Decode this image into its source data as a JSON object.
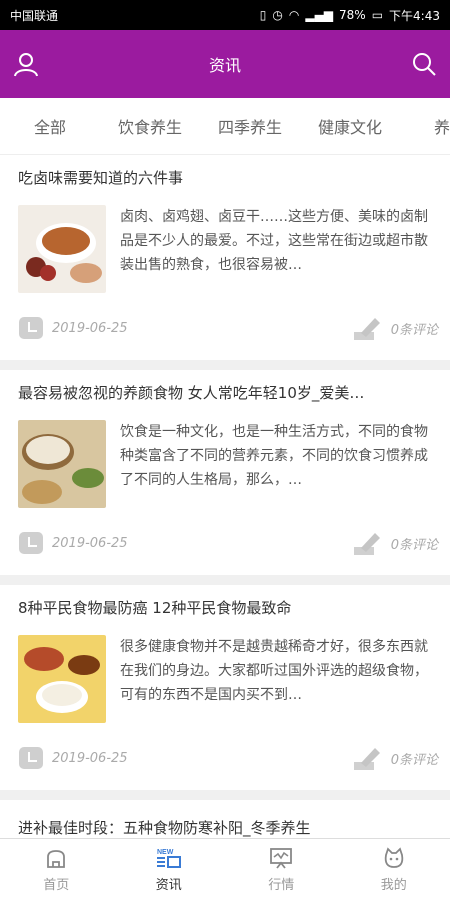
{
  "status_bar": {
    "carrier": "中国联通",
    "battery": "78%",
    "time": "下午4:43",
    "vibrate_icon": "vibrate-icon",
    "alarm_icon": "alarm-icon",
    "wifi_icon": "wifi-icon",
    "signal_icon": "signal-icon",
    "battery_icon": "battery-icon"
  },
  "header": {
    "title": "资讯",
    "user_icon": "user-icon",
    "search_icon": "search-icon",
    "background_color": "#9b1b9f"
  },
  "tabs": [
    {
      "label": "全部"
    },
    {
      "label": "饮食养生"
    },
    {
      "label": "四季养生"
    },
    {
      "label": "健康文化"
    },
    {
      "label": "养心"
    }
  ],
  "articles": [
    {
      "title": "吃卤味需要知道的六件事",
      "summary": "卤肉、卤鸡翅、卤豆干……这些方便、美味的卤制品是不少人的最爱。不过，这些常在街边或超市散装出售的熟食，也很容易被…",
      "date": "2019-06-25",
      "comments": "0条评论",
      "thumb_colors": [
        "#f2ede6",
        "#b7652f",
        "#7a2a1f",
        "#d6a079"
      ]
    },
    {
      "title": "最容易被忽视的养颜食物 女人常吃年轻10岁_爱美…",
      "summary": "饮食是一种文化，也是一种生活方式，不同的食物种类富含了不同的营养元素，不同的饮食习惯养成了不同的人生格局，那么，…",
      "date": "2019-06-25",
      "comments": "0条评论",
      "thumb_colors": [
        "#d8c6a0",
        "#efe7d6",
        "#8f6a3d",
        "#6b8c3a"
      ]
    },
    {
      "title": "8种平民食物最防癌 12种平民食物最致命",
      "summary": "很多健康食物并不是越贵越稀奇才好，很多东西就在我们的身边。大家都听过国外评选的超级食物，可有的东西不是国内买不到…",
      "date": "2019-06-25",
      "comments": "0条评论",
      "thumb_colors": [
        "#f2d36a",
        "#f4efe2",
        "#b54b2a",
        "#7a3b12"
      ]
    }
  ],
  "partial_article_title": "进补最佳时段：五种食物防寒补阳_冬季养生",
  "bottom_nav": [
    {
      "label": "首页",
      "icon": "home-icon",
      "active": false
    },
    {
      "label": "资讯",
      "icon": "news-icon",
      "badge": "NEW",
      "active": true
    },
    {
      "label": "行情",
      "icon": "market-icon",
      "active": false
    },
    {
      "label": "我的",
      "icon": "profile-icon",
      "active": false
    }
  ],
  "colors": {
    "accent": "#9b1b9f",
    "meta_gray": "#aaaaaa",
    "separator": "#f0f0f0"
  }
}
